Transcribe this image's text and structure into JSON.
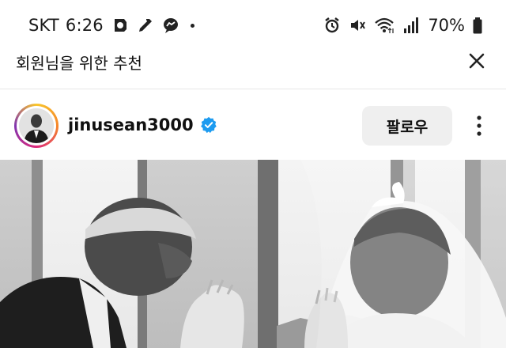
{
  "status_bar": {
    "carrier": "SKT",
    "time": "6:26",
    "battery": "70%",
    "icons_left": [
      "notification-app-icon",
      "edit-app-icon",
      "messenger-icon",
      "more-dot-icon"
    ],
    "icons_right": [
      "alarm-icon",
      "mute-icon",
      "wifi-icon",
      "signal-icon",
      "battery-icon"
    ]
  },
  "header": {
    "title": "회원님을 위한 추천",
    "close_icon": "close-icon"
  },
  "post": {
    "username": "jinusean3000",
    "verified": true,
    "follow_label": "팔로우",
    "more_icon": "more-vertical-icon"
  },
  "colors": {
    "verified_blue": "#1d9bf0",
    "follow_bg": "#efefef",
    "divider": "#e6e6e6"
  }
}
